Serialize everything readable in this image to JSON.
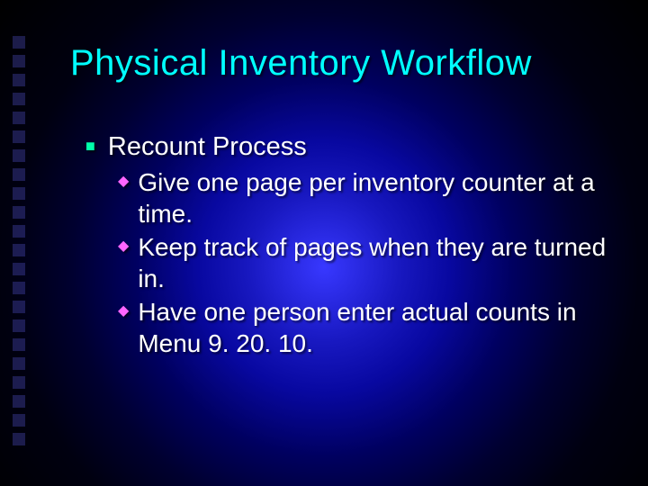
{
  "title": "Physical Inventory Workflow",
  "level1": {
    "bullet_glyph": "■",
    "text": "Recount Process"
  },
  "level2": {
    "bullet_glyph": "◆",
    "items": [
      "Give one page per inventory counter at a time.",
      "Keep track of pages when they are turned in.",
      "Have one person enter actual counts in Menu 9. 20. 10."
    ]
  },
  "colors": {
    "title": "#00ffff",
    "body_text": "#ffffff",
    "level1_bullet": "#00ffaa",
    "level2_bullet": "#ff66ff"
  }
}
